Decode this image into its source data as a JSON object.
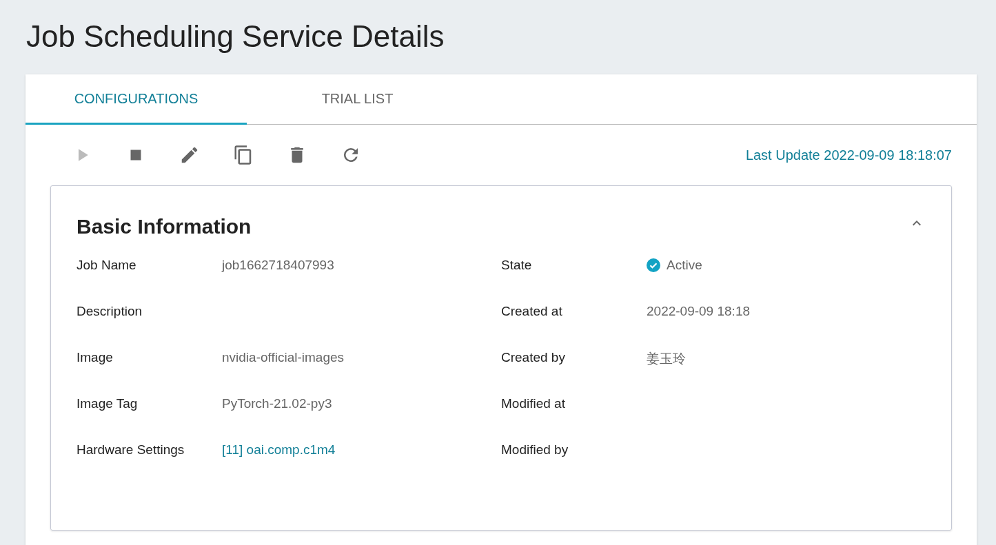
{
  "page_title": "Job Scheduling Service Details",
  "tabs": [
    {
      "label": "CONFIGURATIONS",
      "selected": true
    },
    {
      "label": "TRIAL LIST",
      "selected": false
    }
  ],
  "toolbar": [
    {
      "kind": "play",
      "disabled": true
    },
    {
      "kind": "stop",
      "disabled": false
    },
    {
      "kind": "edit",
      "disabled": false
    },
    {
      "kind": "copy",
      "disabled": false
    },
    {
      "kind": "delete",
      "disabled": false
    },
    {
      "kind": "refresh",
      "disabled": false
    }
  ],
  "last_update": "Last Update 2022-09-09 18:18:07",
  "panel": {
    "title": "Basic Information",
    "expanded": true,
    "left_fields": [
      {
        "label": "Job Name",
        "value": "job1662718407993",
        "kind": "text"
      },
      {
        "label": "Description",
        "kind": "text"
      },
      {
        "label": "Image",
        "value": "nvidia-official-images",
        "kind": "text"
      },
      {
        "label": "Image Tag",
        "value": "PyTorch-21.02-py3",
        "kind": "text"
      },
      {
        "label": "Hardware Settings",
        "value": "[11] oai.comp.c1m4",
        "kind": "link"
      }
    ],
    "right_fields": [
      {
        "label": "State",
        "value": "Active",
        "kind": "status"
      },
      {
        "label": "Created at",
        "value": "2022-09-09 18:18",
        "kind": "text"
      },
      {
        "label": "Created by",
        "value": "姜玉玲",
        "kind": "text"
      },
      {
        "label": "Modified at",
        "kind": "text"
      },
      {
        "label": "Modified by",
        "kind": "text"
      }
    ]
  }
}
